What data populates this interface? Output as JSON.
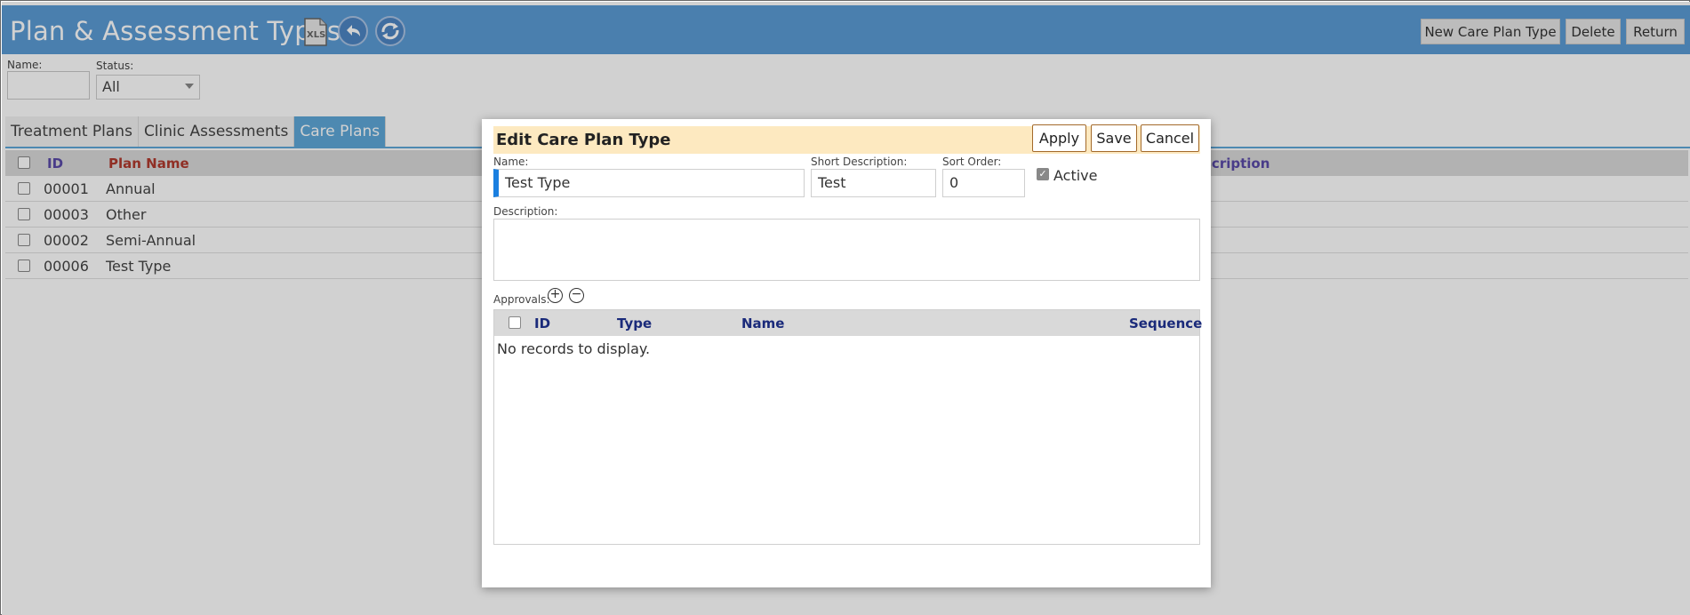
{
  "header": {
    "title": "Plan & Assessment Types",
    "xls_label": "XLS",
    "buttons": {
      "new": "New Care Plan Type",
      "delete": "Delete",
      "return": "Return"
    }
  },
  "filters": {
    "name_label": "Name:",
    "name_value": "",
    "status_label": "Status:",
    "status_value": "All"
  },
  "tabs": [
    {
      "label": "Treatment Plans",
      "active": false
    },
    {
      "label": "Clinic Assessments",
      "active": false
    },
    {
      "label": "Care Plans",
      "active": true
    }
  ],
  "grid": {
    "columns": {
      "id": "ID",
      "plan_name": "Plan Name",
      "description_partial": "scription"
    },
    "rows": [
      {
        "id": "00001",
        "name": "Annual"
      },
      {
        "id": "00003",
        "name": "Other"
      },
      {
        "id": "00002",
        "name": "Semi-Annual"
      },
      {
        "id": "00006",
        "name": "Test Type"
      }
    ]
  },
  "modal": {
    "title": "Edit Care Plan Type",
    "buttons": {
      "apply": "Apply",
      "save": "Save",
      "cancel": "Cancel"
    },
    "name_label": "Name:",
    "name_value": "Test Type",
    "short_desc_label": "Short Description:",
    "short_desc_value": "Test",
    "sort_order_label": "Sort Order:",
    "sort_order_value": "0",
    "active_label": "Active",
    "active_checked": true,
    "description_label": "Description:",
    "description_value": "",
    "approvals_label": "Approvals:",
    "approvals_grid": {
      "columns": {
        "id": "ID",
        "type": "Type",
        "name": "Name",
        "sequence": "Sequence"
      },
      "empty_text": "No records to display."
    }
  },
  "colors": {
    "header_bg": "#5b9bd5",
    "tab_active": "#5fa8d8",
    "modal_titlebar": "#fde9c0",
    "id_header": "#5a4aa8",
    "planname_header": "#b03a2e",
    "modal_header_text": "#1a2a7a"
  }
}
